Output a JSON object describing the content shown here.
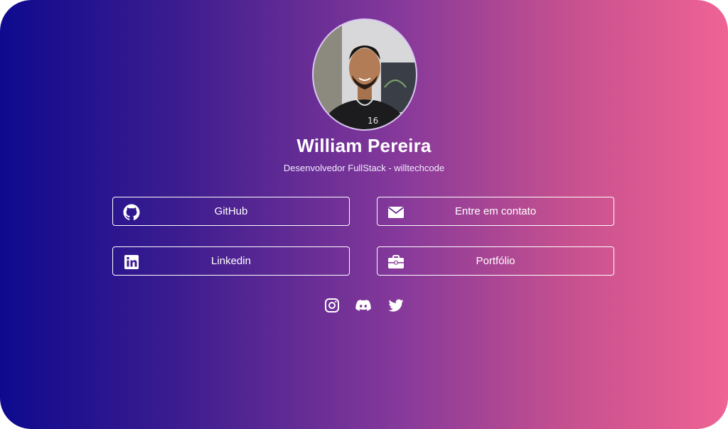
{
  "profile": {
    "name": "William Pereira",
    "subtitle": "Desenvolvedor FullStack - willtechcode"
  },
  "links": {
    "github": {
      "label": "GitHub",
      "icon": "github-icon"
    },
    "contact": {
      "label": "Entre em contato",
      "icon": "envelope-icon"
    },
    "linkedin": {
      "label": "Linkedin",
      "icon": "linkedin-icon"
    },
    "portfolio": {
      "label": "Portfólio",
      "icon": "briefcase-icon"
    }
  },
  "social": [
    {
      "icon": "instagram-icon"
    },
    {
      "icon": "discord-icon"
    },
    {
      "icon": "twitter-icon"
    }
  ],
  "colors": {
    "gradient_start": "#0e0a8e",
    "gradient_end": "#ef6394",
    "text": "#ffffff"
  }
}
